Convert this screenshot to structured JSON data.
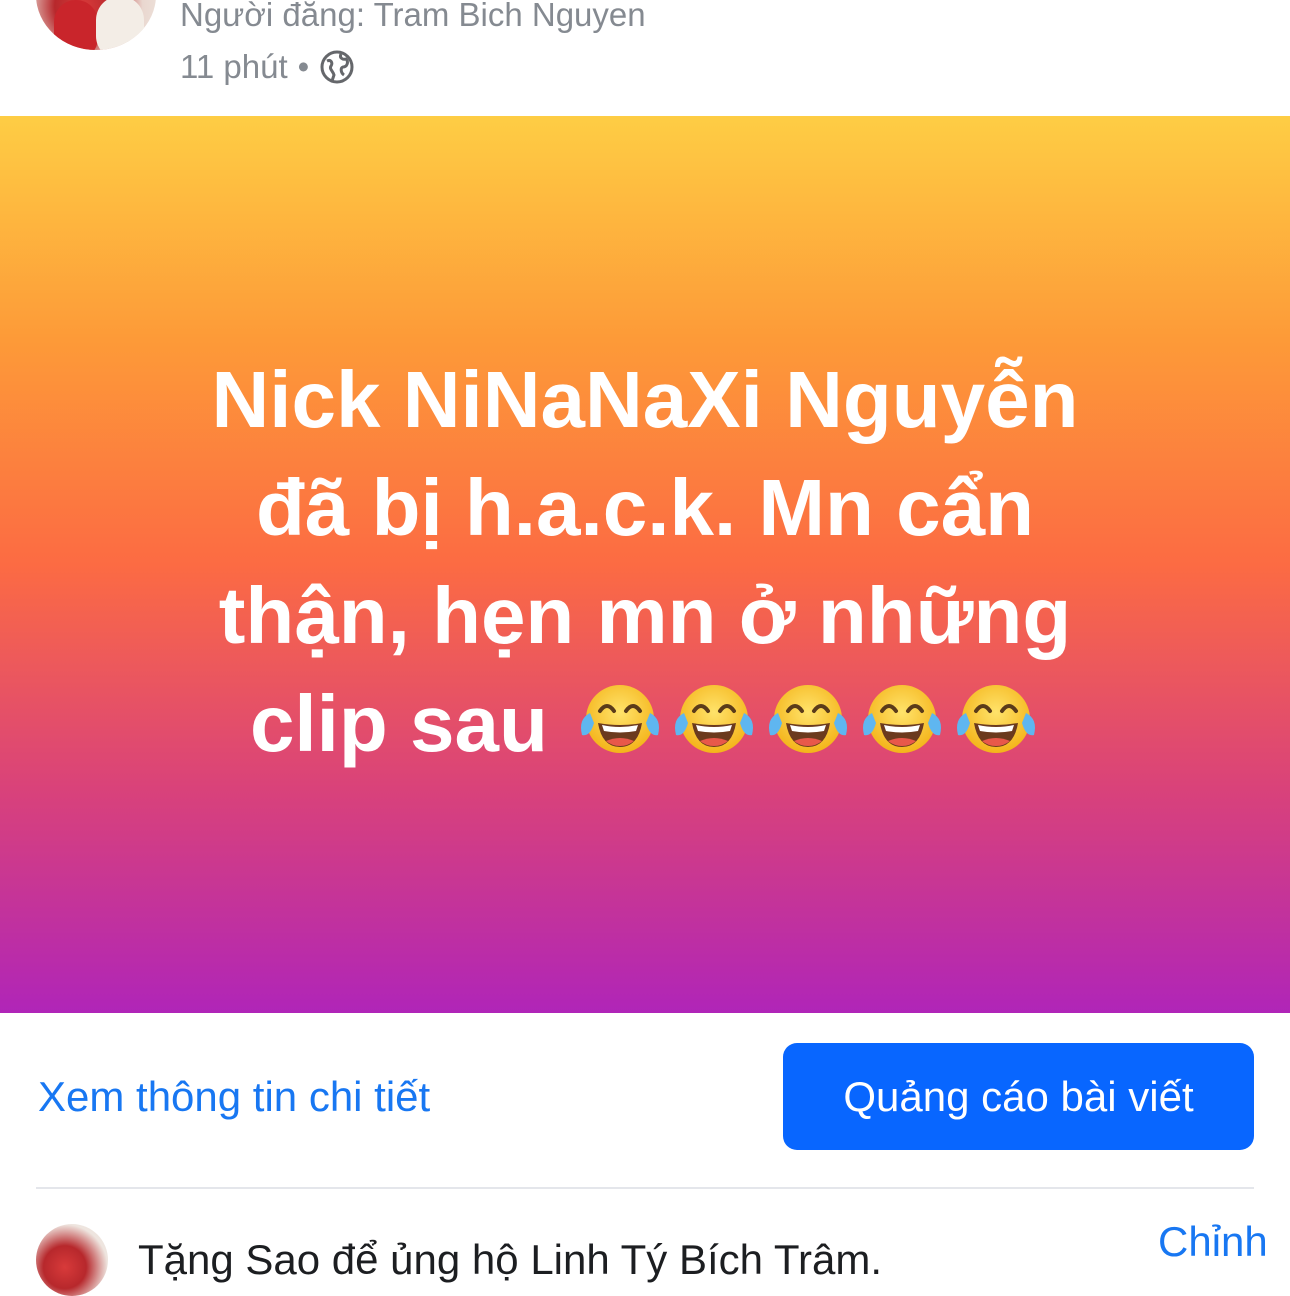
{
  "header": {
    "posted_by": "Người đăng: Tram Bich Nguyen",
    "time": "11 phút",
    "separator": "•"
  },
  "post": {
    "text_line1": "Nick NiNaNaXi Nguyễn",
    "text_line2": "đã bị h.a.c.k. Mn cẩn",
    "text_line3": "thận, hẹn mn ở những",
    "text_line4": "clip sau",
    "emoji_count": 5,
    "gradient_colors": [
      "#fecd44",
      "#fd9a38",
      "#fc6b43",
      "#d9427a",
      "#b025b8"
    ]
  },
  "actions": {
    "detail_link": "Xem thông tin chi tiết",
    "promote_button": "Quảng cáo bài viết"
  },
  "footer": {
    "stars_text": "Tặng Sao để ủng hộ Linh Tý Bích Trâm.",
    "edit_link": "Chỉnh"
  },
  "colors": {
    "link": "#1877f2",
    "button": "#0866ff",
    "meta_text": "#858a91"
  }
}
